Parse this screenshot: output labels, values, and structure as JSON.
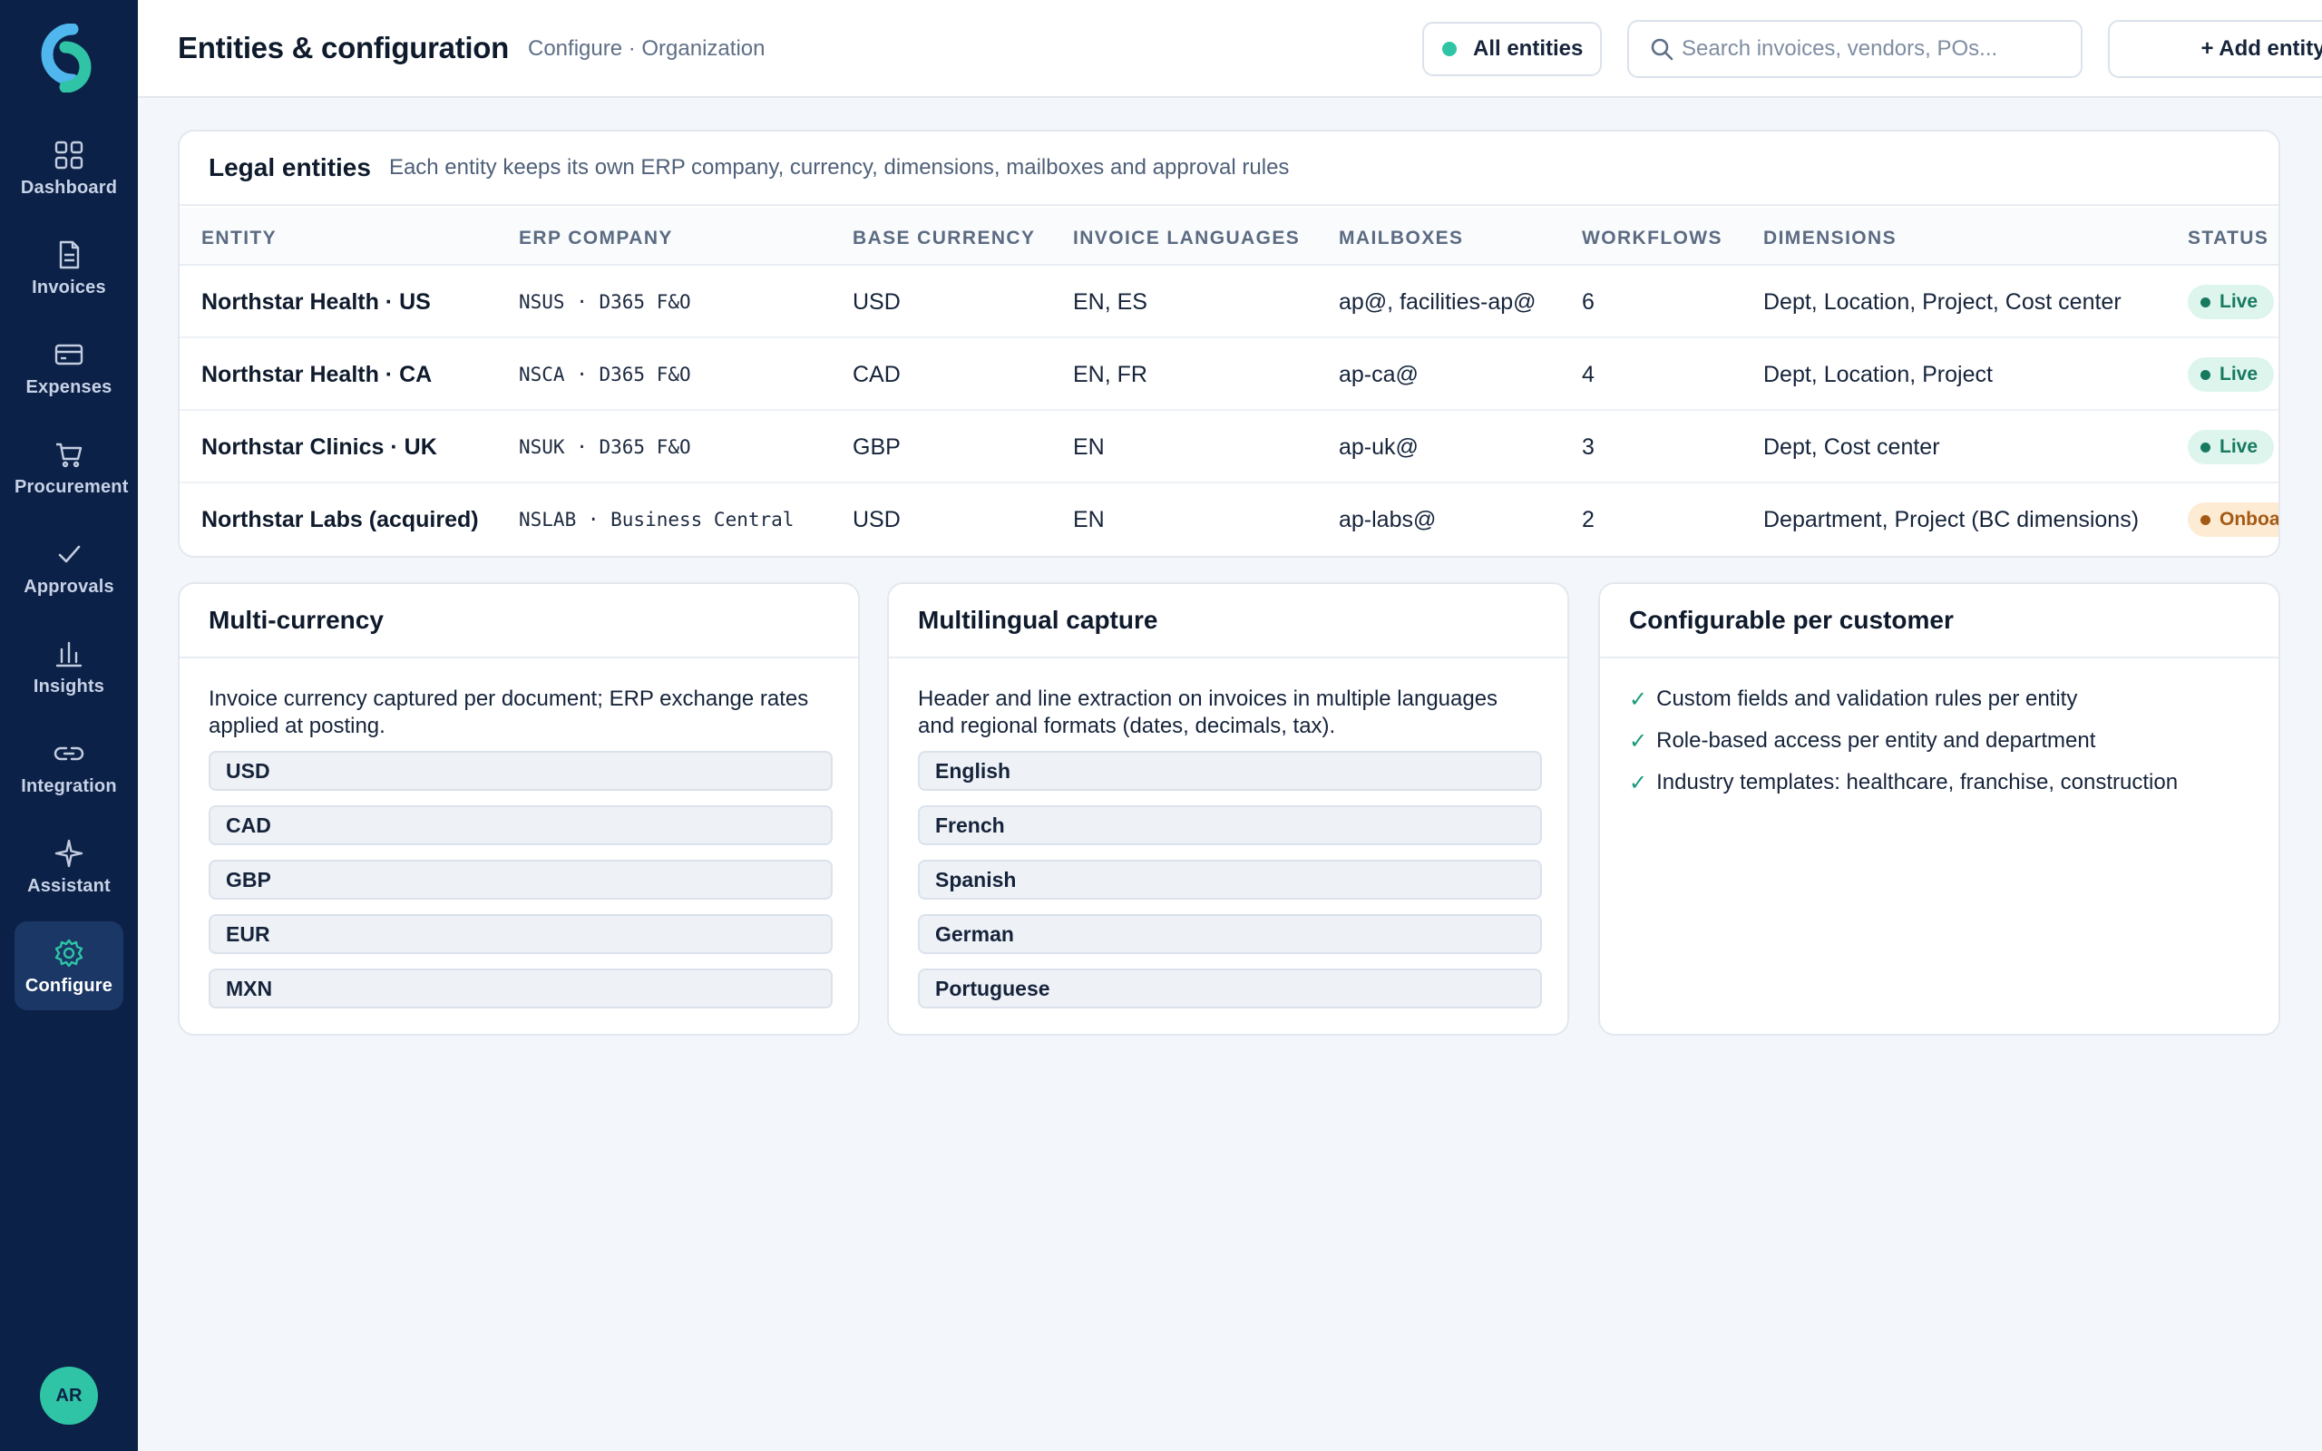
{
  "sidebar": {
    "items": [
      {
        "label": "Dashboard",
        "icon": "grid-icon"
      },
      {
        "label": "Invoices",
        "icon": "document-icon"
      },
      {
        "label": "Expenses",
        "icon": "card-icon"
      },
      {
        "label": "Procurement",
        "icon": "cart-icon"
      },
      {
        "label": "Approvals",
        "icon": "check-icon"
      },
      {
        "label": "Insights",
        "icon": "bar-chart-icon"
      },
      {
        "label": "Integration",
        "icon": "link-icon"
      },
      {
        "label": "Assistant",
        "icon": "sparkle-icon"
      },
      {
        "label": "Configure",
        "icon": "gear-icon",
        "active": true
      }
    ],
    "avatar_initials": "AR"
  },
  "header": {
    "title": "Entities & configuration",
    "breadcrumb": "Configure · Organization",
    "entity_filter_label": "All entities",
    "search_placeholder": "Search invoices, vendors, POs...",
    "add_button_label": "+ Add entity"
  },
  "entities": {
    "title": "Legal entities",
    "subtitle": "Each entity keeps its own ERP company, currency, dimensions, mailboxes and approval rules",
    "columns": [
      "ENTITY",
      "ERP COMPANY",
      "BASE CURRENCY",
      "INVOICE LANGUAGES",
      "MAILBOXES",
      "WORKFLOWS",
      "DIMENSIONS",
      "STATUS"
    ],
    "rows": [
      {
        "entity": "Northstar Health · US",
        "erp": "NSUS · D365 F&O",
        "currency": "USD",
        "languages": "EN, ES",
        "mailboxes": "ap@, facilities-ap@",
        "workflows": "6",
        "dimensions": "Dept, Location, Project, Cost center",
        "status": "Live"
      },
      {
        "entity": "Northstar Health · CA",
        "erp": "NSCA · D365 F&O",
        "currency": "CAD",
        "languages": "EN, FR",
        "mailboxes": "ap-ca@",
        "workflows": "4",
        "dimensions": "Dept, Location, Project",
        "status": "Live"
      },
      {
        "entity": "Northstar Clinics · UK",
        "erp": "NSUK · D365 F&O",
        "currency": "GBP",
        "languages": "EN",
        "mailboxes": "ap-uk@",
        "workflows": "3",
        "dimensions": "Dept, Cost center",
        "status": "Live"
      },
      {
        "entity": "Northstar Labs (acquired)",
        "erp": "NSLAB · Business Central",
        "currency": "USD",
        "languages": "EN",
        "mailboxes": "ap-labs@",
        "workflows": "2",
        "dimensions": "Department, Project (BC dimensions)",
        "status": "Onboa"
      }
    ]
  },
  "multi_currency": {
    "title": "Multi-currency",
    "description": "Invoice currency captured per document; ERP exchange rates applied at posting.",
    "currencies": [
      "USD",
      "CAD",
      "GBP",
      "EUR",
      "MXN"
    ]
  },
  "multilingual": {
    "title": "Multilingual capture",
    "description": "Header and line extraction on invoices in multiple languages and regional formats (dates, decimals, tax).",
    "languages": [
      "English",
      "French",
      "Spanish",
      "German",
      "Portuguese"
    ]
  },
  "configurable": {
    "title": "Configurable per customer",
    "check_mark": "✓",
    "items": [
      "Custom fields and validation rules per entity",
      "Role-based access per entity and department",
      "Industry templates: healthcare, franchise, construction"
    ]
  },
  "colors": {
    "sidebar_bg": "#0c2147",
    "accent": "#2ec4a5",
    "live_badge": "#177a5f",
    "onboarding_badge": "#a45a14"
  }
}
